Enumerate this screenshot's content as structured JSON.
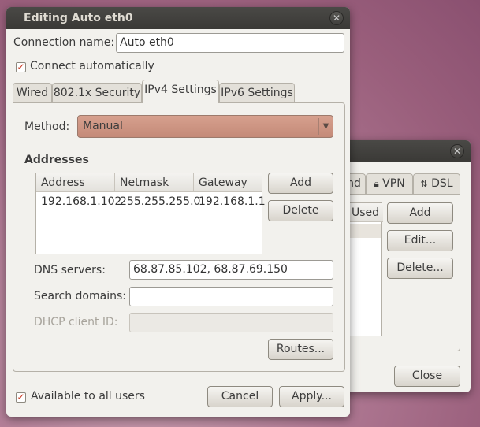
{
  "back_window": {
    "tabs": [
      "nd",
      "VPN",
      "DSL"
    ],
    "column_header": "Used",
    "buttons": {
      "add": "Add",
      "edit": "Edit...",
      "delete": "Delete...",
      "close": "Close"
    }
  },
  "dialog": {
    "title": "Editing Auto eth0",
    "connection_name_label": "Connection name:",
    "connection_name_value": "Auto eth0",
    "connect_automatically_label": "Connect automatically",
    "connect_automatically_checked": true,
    "tabs": [
      "Wired",
      "802.1x Security",
      "IPv4 Settings",
      "IPv6 Settings"
    ],
    "active_tab": "IPv4 Settings",
    "method_label": "Method:",
    "method_value": "Manual",
    "addresses_heading": "Addresses",
    "address_columns": [
      "Address",
      "Netmask",
      "Gateway"
    ],
    "address_rows": [
      [
        "192.168.1.102",
        "255.255.255.0",
        "192.168.1.1"
      ]
    ],
    "add_button": "Add",
    "delete_button": "Delete",
    "dns_label": "DNS servers:",
    "dns_value": "68.87.85.102, 68.87.69.150",
    "search_domains_label": "Search domains:",
    "search_domains_value": "",
    "dhcp_label": "DHCP client ID:",
    "dhcp_value": "",
    "routes_button": "Routes...",
    "available_all_users_label": "Available to all users",
    "available_all_users_checked": true,
    "cancel_button": "Cancel",
    "apply_button": "Apply..."
  }
}
